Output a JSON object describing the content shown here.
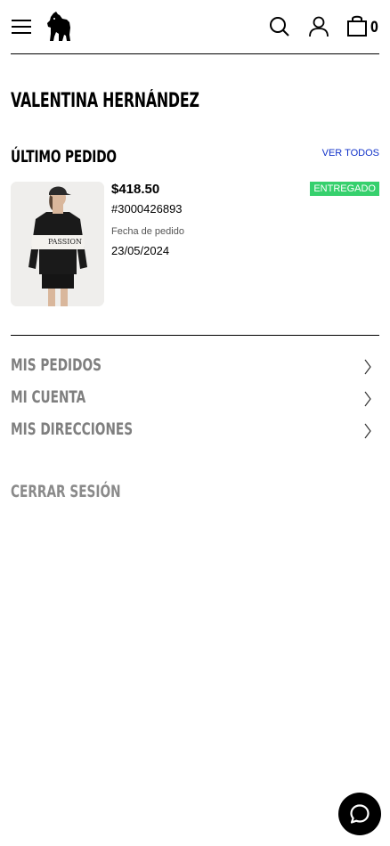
{
  "header": {
    "menu_icon": "hamburger-icon",
    "logo_icon": "dog-logo-icon",
    "search_icon": "search-icon",
    "account_icon": "user-icon",
    "cart_icon": "shopping-bag-icon",
    "cart_count": "0"
  },
  "profile": {
    "name": "VALENTINA HERNÁNDEZ"
  },
  "last_order": {
    "heading": "ÚLTIMO PEDIDO",
    "see_all_label": "VER TODOS",
    "price": "$418.50",
    "order_number": "#3000426893",
    "date_label": "Fecha de pedido",
    "date": "23/05/2024",
    "status": "ENTREGADO",
    "thumbnail_text": "PASSION"
  },
  "menu": {
    "items": [
      {
        "label": "MIS PEDIDOS"
      },
      {
        "label": "MI CUENTA"
      },
      {
        "label": "MIS DIRECCIONES"
      }
    ]
  },
  "logout_label": "CERRAR SESIÓN",
  "colors": {
    "accent_link": "#1132c9",
    "status_delivered": "#36d06d",
    "muted_text": "#7f7f7f"
  },
  "chat_icon": "chat-bubble-icon"
}
